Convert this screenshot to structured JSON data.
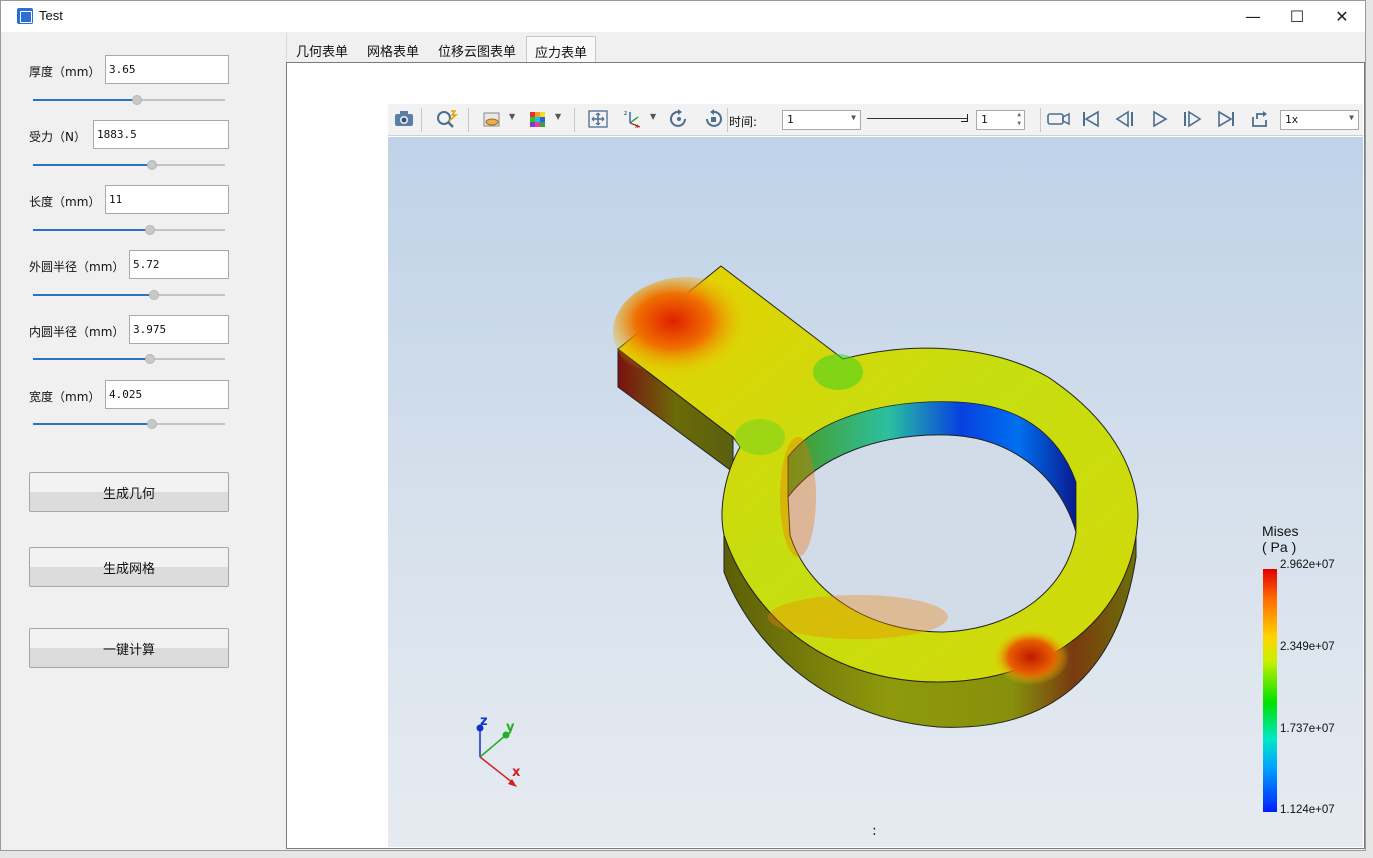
{
  "window": {
    "title": "Test"
  },
  "params": [
    {
      "label": "厚度（mm）",
      "value": "3.65",
      "slider_pct": 0.54
    },
    {
      "label": "受力（N）",
      "value": "1883.5",
      "slider_pct": 0.62
    },
    {
      "label": "长度（mm）",
      "value": "11",
      "slider_pct": 0.61
    },
    {
      "label": "外圆半径（mm）",
      "value": "5.72",
      "slider_pct": 0.63
    },
    {
      "label": "内圆半径（mm）",
      "value": "3.975",
      "slider_pct": 0.61
    },
    {
      "label": "宽度（mm）",
      "value": "4.025",
      "slider_pct": 0.62
    }
  ],
  "buttons": {
    "generate_geometry": "生成几何",
    "generate_mesh": "生成网格",
    "compute": "一键计算"
  },
  "tabs": [
    {
      "label": "几何表单",
      "active": false
    },
    {
      "label": "网格表单",
      "active": false
    },
    {
      "label": "位移云图表单",
      "active": false
    },
    {
      "label": "应力表单",
      "active": true
    }
  ],
  "toolbar": {
    "time_label": "时间:",
    "time_combo_value": "1",
    "time_slider_pct": 1.0,
    "time_spin_value": "1",
    "speed_value": "1x"
  },
  "legend": {
    "title_line1": "Mises",
    "title_line2": "( Pa )",
    "labels": [
      "2.962e+07",
      "2.349e+07",
      "1.737e+07",
      "1.124e+07"
    ]
  },
  "axes": {
    "z": "z",
    "y": "y",
    "x": "x"
  },
  "status": ":",
  "colors": {
    "accent": "#2a72c9",
    "viewport_top": "#bfd2e8",
    "viewport_bottom": "#e6ebf1"
  }
}
